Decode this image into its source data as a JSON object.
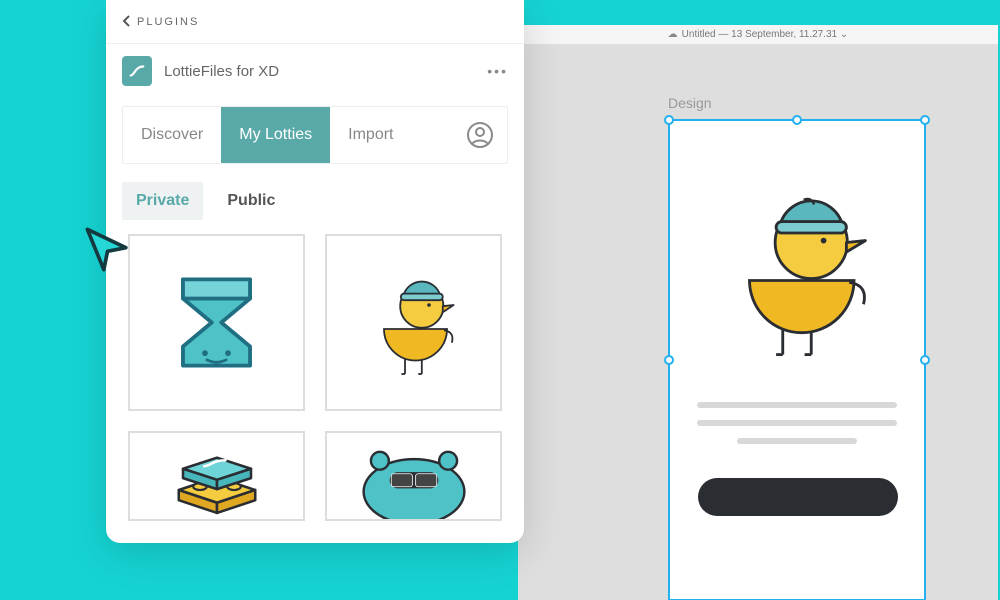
{
  "xd": {
    "title": "Untitled — 13 September, 11.27.31 ⌄",
    "artboard_label": "Design"
  },
  "panel": {
    "header_title": "PLUGINS",
    "plugin_name": "LottieFiles for XD",
    "tabs": {
      "discover": "Discover",
      "my_lotties": "My Lotties",
      "import": "Import"
    },
    "subtabs": {
      "private": "Private",
      "public": "Public"
    }
  },
  "colors": {
    "accent": "#5aa9a9",
    "bg": "#16d3d3",
    "selection": "#21b0f0"
  }
}
